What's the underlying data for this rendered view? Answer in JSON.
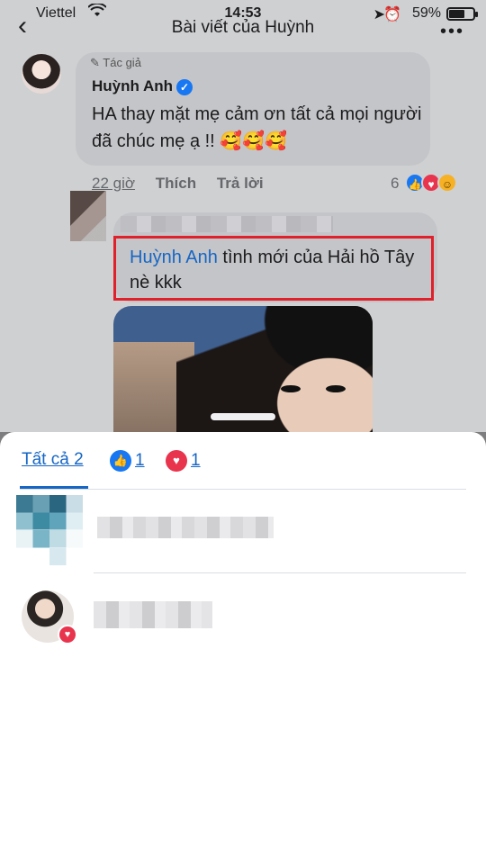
{
  "status_bar": {
    "carrier": "Viettel",
    "time": "14:53",
    "battery_percent": "59%",
    "battery_level": 0.59
  },
  "navbar": {
    "back_icon": "chevron-left-icon",
    "title": "Bài viết của Huỳnh",
    "more_icon": "more-dots-icon"
  },
  "comment1": {
    "badge": "Tác giả",
    "author": "Huỳnh Anh",
    "text": "HA thay mặt mẹ cảm ơn tất cả mọi người đã chúc mẹ ạ !! 🥰🥰🥰",
    "time": "22 giờ",
    "like_label": "Thích",
    "reply_label": "Trả lời",
    "reaction_count": "6"
  },
  "comment2": {
    "mention": "Huỳnh Anh",
    "text": " tình mới của Hải hồ Tây nè kkk"
  },
  "sheet": {
    "tabs": [
      {
        "label": "Tất cả 2"
      },
      {
        "icon": "like-icon",
        "count": "1"
      },
      {
        "icon": "love-icon",
        "count": "1"
      }
    ]
  },
  "colors": {
    "accent": "#1666c5",
    "like": "#1877f2",
    "love": "#e8344d",
    "highlight_border": "#e0202a"
  }
}
